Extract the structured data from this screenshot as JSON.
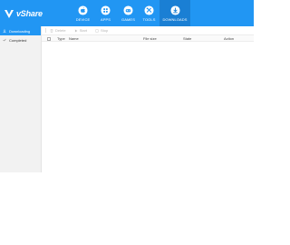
{
  "app": {
    "brand": "vShare",
    "brand_color": "#2196f3",
    "nav": [
      {
        "label": "DEVICE",
        "icon": "apple-icon"
      },
      {
        "label": "APPS",
        "icon": "apps-grid-icon"
      },
      {
        "label": "GAMES",
        "icon": "gamepad-icon"
      },
      {
        "label": "TOOLS",
        "icon": "tools-icon"
      },
      {
        "label": "DOWNLOADS",
        "icon": "download-icon",
        "active": true
      }
    ]
  },
  "sidebar": {
    "items": [
      {
        "label": "Downloading",
        "icon": "download-icon",
        "active": true
      },
      {
        "label": "Completed",
        "icon": "check-icon",
        "active": false
      }
    ]
  },
  "toolbar": {
    "delete_label": "Delete",
    "start_label": "Start",
    "stop_label": "Stop"
  },
  "table": {
    "columns": [
      "Type",
      "Name",
      "File size",
      "State",
      "Action"
    ],
    "rows": []
  }
}
